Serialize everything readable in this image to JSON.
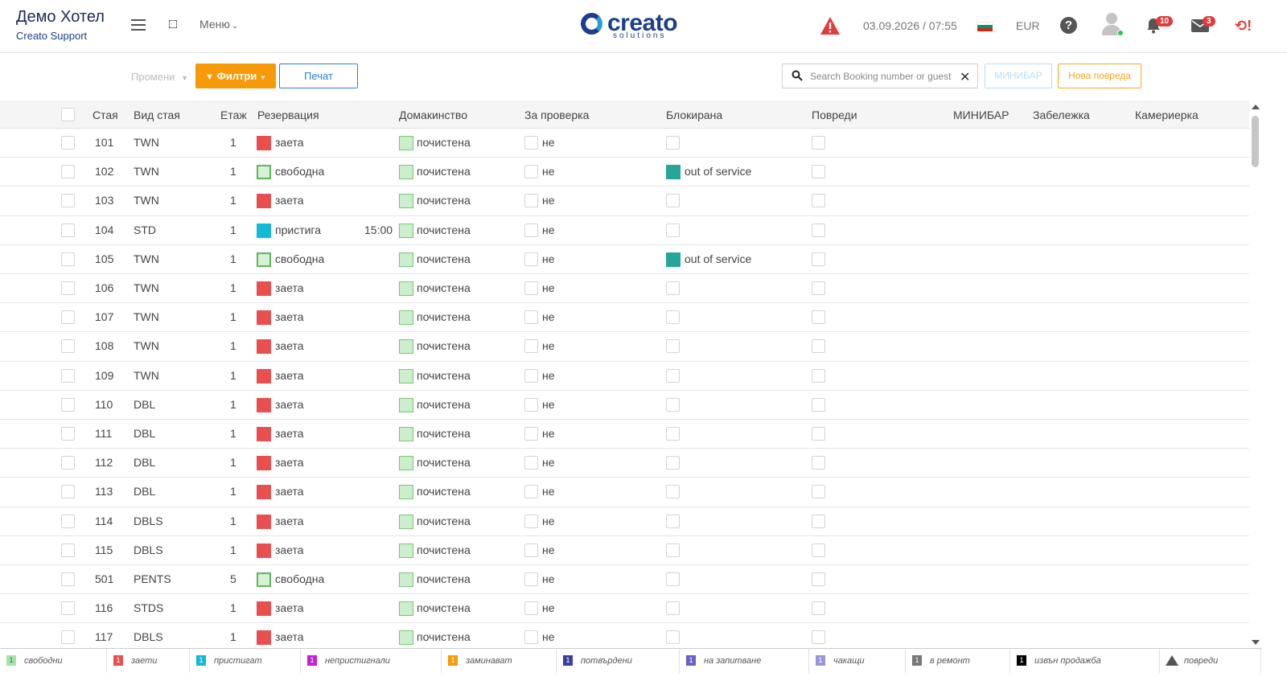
{
  "header": {
    "hotel_name": "Демо Хотел",
    "hotel_sub": "Creato Support",
    "menu_label": "Меню",
    "logo_word": "creato",
    "logo_sub": "solutions",
    "datetime": "03.09.2026 / 07:55",
    "currency": "EUR",
    "notifications_count": "10",
    "messages_count": "3",
    "colors": {
      "brand": "#1b3f8a",
      "warning": "#e23b3b",
      "accent": "#f79a0a"
    }
  },
  "toolbar": {
    "change_label": "Промени",
    "filters_label": "Филтри",
    "print_label": "Печат",
    "search_placeholder": "Search Booking number or guest",
    "minibar_label": "МИНИБАР",
    "new_damage_label": "Нова повреда"
  },
  "table": {
    "headers": [
      "Стая",
      "Вид стая",
      "Етаж",
      "Резервация",
      "Домакинство",
      "За проверка",
      "Блокирана",
      "Повреди",
      "МИНИБАР",
      "Забележка",
      "Камериерка"
    ],
    "rows": [
      {
        "room": "101",
        "type": "TWN",
        "floor": "1",
        "res": "заета",
        "res_status": "occupied",
        "time": "",
        "hk": "почистена",
        "check": "не",
        "blocked": ""
      },
      {
        "room": "102",
        "type": "TWN",
        "floor": "1",
        "res": "свободна",
        "res_status": "free",
        "time": "",
        "hk": "почистена",
        "check": "не",
        "blocked": "out of service"
      },
      {
        "room": "103",
        "type": "TWN",
        "floor": "1",
        "res": "заета",
        "res_status": "occupied",
        "time": "",
        "hk": "почистена",
        "check": "не",
        "blocked": ""
      },
      {
        "room": "104",
        "type": "STD",
        "floor": "1",
        "res": "пристига",
        "res_status": "arriving",
        "time": "15:00",
        "hk": "почистена",
        "check": "не",
        "blocked": ""
      },
      {
        "room": "105",
        "type": "TWN",
        "floor": "1",
        "res": "свободна",
        "res_status": "free",
        "time": "",
        "hk": "почистена",
        "check": "не",
        "blocked": "out of service"
      },
      {
        "room": "106",
        "type": "TWN",
        "floor": "1",
        "res": "заета",
        "res_status": "occupied",
        "time": "",
        "hk": "почистена",
        "check": "не",
        "blocked": ""
      },
      {
        "room": "107",
        "type": "TWN",
        "floor": "1",
        "res": "заета",
        "res_status": "occupied",
        "time": "",
        "hk": "почистена",
        "check": "не",
        "blocked": ""
      },
      {
        "room": "108",
        "type": "TWN",
        "floor": "1",
        "res": "заета",
        "res_status": "occupied",
        "time": "",
        "hk": "почистена",
        "check": "не",
        "blocked": ""
      },
      {
        "room": "109",
        "type": "TWN",
        "floor": "1",
        "res": "заета",
        "res_status": "occupied",
        "time": "",
        "hk": "почистена",
        "check": "не",
        "blocked": ""
      },
      {
        "room": "110",
        "type": "DBL",
        "floor": "1",
        "res": "заета",
        "res_status": "occupied",
        "time": "",
        "hk": "почистена",
        "check": "не",
        "blocked": ""
      },
      {
        "room": "111",
        "type": "DBL",
        "floor": "1",
        "res": "заета",
        "res_status": "occupied",
        "time": "",
        "hk": "почистена",
        "check": "не",
        "blocked": ""
      },
      {
        "room": "112",
        "type": "DBL",
        "floor": "1",
        "res": "заета",
        "res_status": "occupied",
        "time": "",
        "hk": "почистена",
        "check": "не",
        "blocked": ""
      },
      {
        "room": "113",
        "type": "DBL",
        "floor": "1",
        "res": "заета",
        "res_status": "occupied",
        "time": "",
        "hk": "почистена",
        "check": "не",
        "blocked": ""
      },
      {
        "room": "114",
        "type": "DBLS",
        "floor": "1",
        "res": "заета",
        "res_status": "occupied",
        "time": "",
        "hk": "почистена",
        "check": "не",
        "blocked": ""
      },
      {
        "room": "115",
        "type": "DBLS",
        "floor": "1",
        "res": "заета",
        "res_status": "occupied",
        "time": "",
        "hk": "почистена",
        "check": "не",
        "blocked": ""
      },
      {
        "room": "501",
        "type": "PENTS",
        "floor": "5",
        "res": "свободна",
        "res_status": "free",
        "time": "",
        "hk": "почистена",
        "check": "не",
        "blocked": ""
      },
      {
        "room": "116",
        "type": "STDS",
        "floor": "1",
        "res": "заета",
        "res_status": "occupied",
        "time": "",
        "hk": "почистена",
        "check": "не",
        "blocked": ""
      },
      {
        "room": "117",
        "type": "DBLS",
        "floor": "1",
        "res": "заета",
        "res_status": "occupied",
        "time": "",
        "hk": "почистена",
        "check": "не",
        "blocked": ""
      }
    ]
  },
  "legend": [
    {
      "count": "1",
      "label": "свободни",
      "color": "#a6e3a6",
      "text_color": "#2e7d32"
    },
    {
      "count": "1",
      "label": "заети",
      "color": "#ea4f4f",
      "text_color": "#ffffff"
    },
    {
      "count": "1",
      "label": "пристигат",
      "color": "#15b9d8",
      "text_color": "#ffffff"
    },
    {
      "count": "1",
      "label": "непристигнали",
      "color": "#c51fd6",
      "text_color": "#ffffff"
    },
    {
      "count": "1",
      "label": "заминават",
      "color": "#f79a0a",
      "text_color": "#ffffff"
    },
    {
      "count": "1",
      "label": "потвърдени",
      "color": "#3a3f9e",
      "text_color": "#ffffff"
    },
    {
      "count": "1",
      "label": "на запитване",
      "color": "#6a5fc8",
      "text_color": "#ffffff"
    },
    {
      "count": "1",
      "label": "чакащи",
      "color": "#9a94d8",
      "text_color": "#ffffff"
    },
    {
      "count": "1",
      "label": "в ремонт",
      "color": "#777777",
      "text_color": "#ffffff"
    },
    {
      "count": "1",
      "label": "извън продажба",
      "color": "#000000",
      "text_color": "#ffffff"
    },
    {
      "count": "",
      "label": "повреди",
      "color": "#555555",
      "text_color": "#ffffff"
    }
  ]
}
